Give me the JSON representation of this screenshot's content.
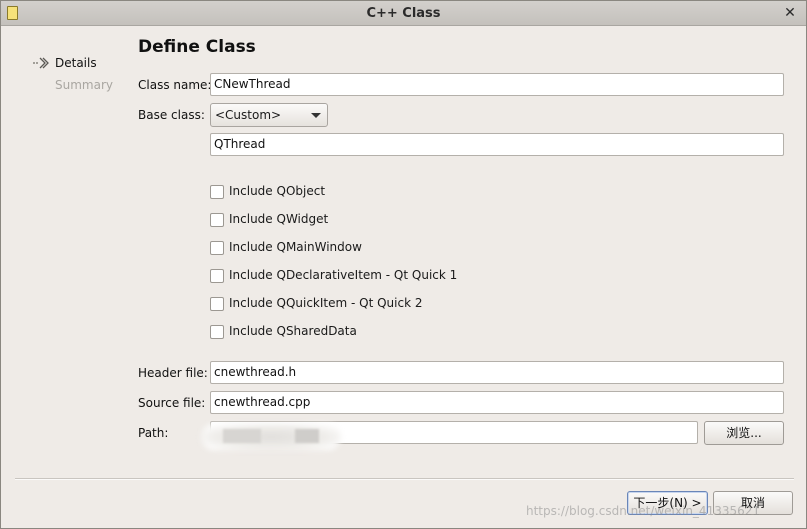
{
  "window": {
    "title": "C++ Class"
  },
  "nav": {
    "items": [
      {
        "label": "Details"
      },
      {
        "label": "Summary"
      }
    ]
  },
  "page": {
    "heading": "Define Class"
  },
  "form": {
    "class_name": {
      "label": "Class name:",
      "value": "CNewThread"
    },
    "base_class": {
      "label": "Base class:",
      "selected": "<Custom>",
      "custom_value": "QThread"
    },
    "includes": [
      {
        "label": "Include QObject",
        "checked": false
      },
      {
        "label": "Include QWidget",
        "checked": false
      },
      {
        "label": "Include QMainWindow",
        "checked": false
      },
      {
        "label": "Include QDeclarativeItem - Qt Quick 1",
        "checked": false
      },
      {
        "label": "Include QQuickItem - Qt Quick 2",
        "checked": false
      },
      {
        "label": "Include QSharedData",
        "checked": false
      }
    ],
    "header_file": {
      "label": "Header file:",
      "value": "cnewthread.h"
    },
    "source_file": {
      "label": "Source file:",
      "value": "cnewthread.cpp"
    },
    "path": {
      "label": "Path:",
      "value": "",
      "browse_label": "浏览..."
    }
  },
  "footer": {
    "next_label": "下一步(N) >",
    "cancel_label": "取消",
    "watermark": "https://blog.csdn.net/weixin_41335621"
  }
}
